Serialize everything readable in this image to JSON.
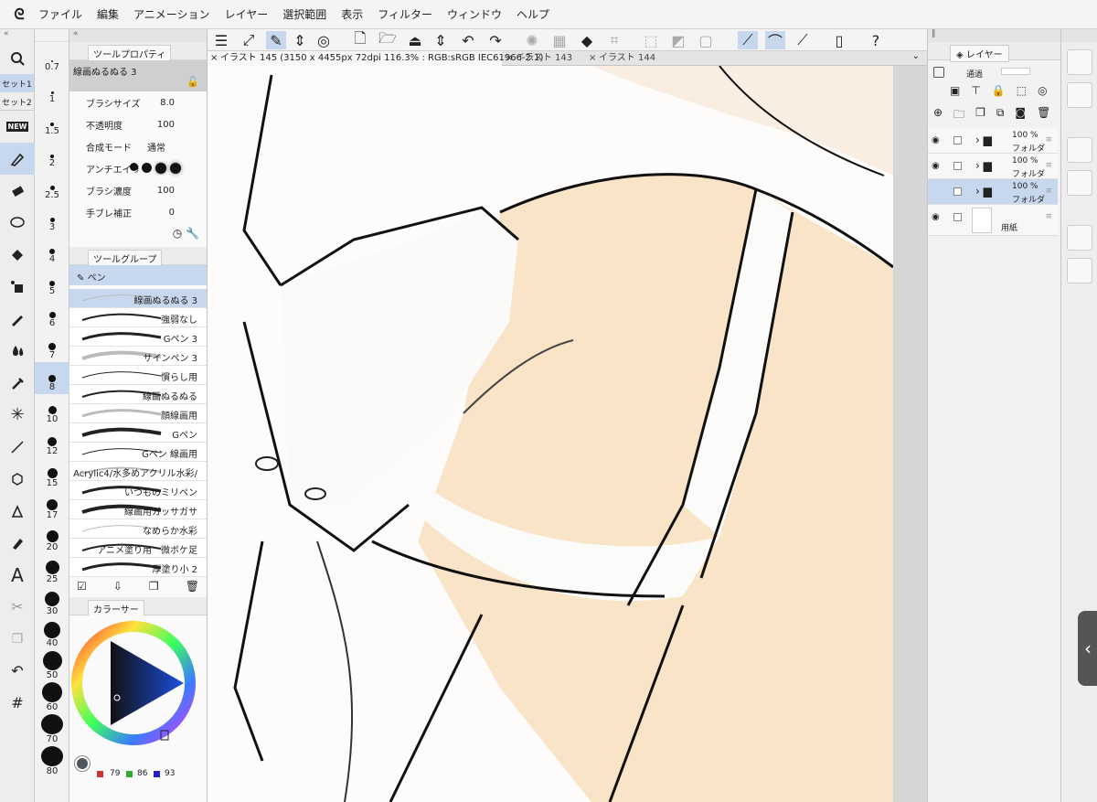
{
  "menu": [
    "ファイル",
    "編集",
    "アニメーション",
    "レイヤー",
    "選択範囲",
    "表示",
    "フィルター",
    "ウィンドウ",
    "ヘルプ"
  ],
  "toolbar": {
    "tools": [
      "eye-icon",
      "new-icon",
      "pen-icon",
      "eraser-icon",
      "lasso-icon",
      "fill-icon",
      "pattern-icon",
      "pencil-icon",
      "blend-icon",
      "dropper-icon",
      "sparkle-icon",
      "line-icon",
      "cube-icon",
      "vector-pen-icon",
      "bucket-icon",
      "text-icon",
      "scissors-icon",
      "copy-icon"
    ],
    "set1": "セット1",
    "set2": "セット2",
    "text_tool": "A"
  },
  "sizes": [
    "0.7",
    "1",
    "1.5",
    "2",
    "2.5",
    "3",
    "4",
    "5",
    "6",
    "7",
    "8",
    "10",
    "12",
    "15",
    "17",
    "20",
    "25",
    "30",
    "40",
    "50",
    "60",
    "70",
    "80"
  ],
  "tool_property": {
    "title": "ツールプロパティ",
    "preset": "線画ぬるぬる 3",
    "rows": [
      {
        "label": "ブラシサイズ",
        "value": "8.0"
      },
      {
        "label": "不透明度",
        "value": "100"
      },
      {
        "label": "合成モード",
        "value": "通常"
      },
      {
        "label": "アンチエイリ",
        "value": ""
      },
      {
        "label": "ブラシ濃度",
        "value": "100"
      },
      {
        "label": "手ブレ補正",
        "value": "0"
      }
    ]
  },
  "tool_group": {
    "title": "ツールグループ",
    "group": "ペン",
    "items": [
      "線画ぬるぬる 3",
      "強弱なし",
      "Gペン 3",
      "サインペン 3",
      "慣らし用",
      "線画ぬるぬる",
      "顔線画用",
      "Gペン",
      "Gペン 線画用",
      "Acrylic4/水多めアクリル水彩/",
      "いつものミリペン",
      "線画用ガッサガサ",
      "なめらか水彩",
      "アニメ塗り用　微ボケ足",
      "厚塗り小 2"
    ]
  },
  "color": {
    "title": "カラーサー",
    "r": "79",
    "g": "86",
    "b": "93",
    "swatch": "#4f565d"
  },
  "canvas_tabs": [
    "イラスト 145 (3150 x 4455px 72dpi 116.3% : RGB:sRGB IEC61966-2.1)",
    "イラスト 143",
    "イラスト 144"
  ],
  "layers": {
    "title": "レイヤー",
    "blend": "通過",
    "rows": [
      {
        "opacity": "100 %",
        "mode": "フォルダ"
      },
      {
        "opacity": "100 %",
        "mode": "フォルダ"
      },
      {
        "opacity": "100 %",
        "mode": "フォルダ"
      },
      {
        "name": "用紙"
      }
    ]
  }
}
